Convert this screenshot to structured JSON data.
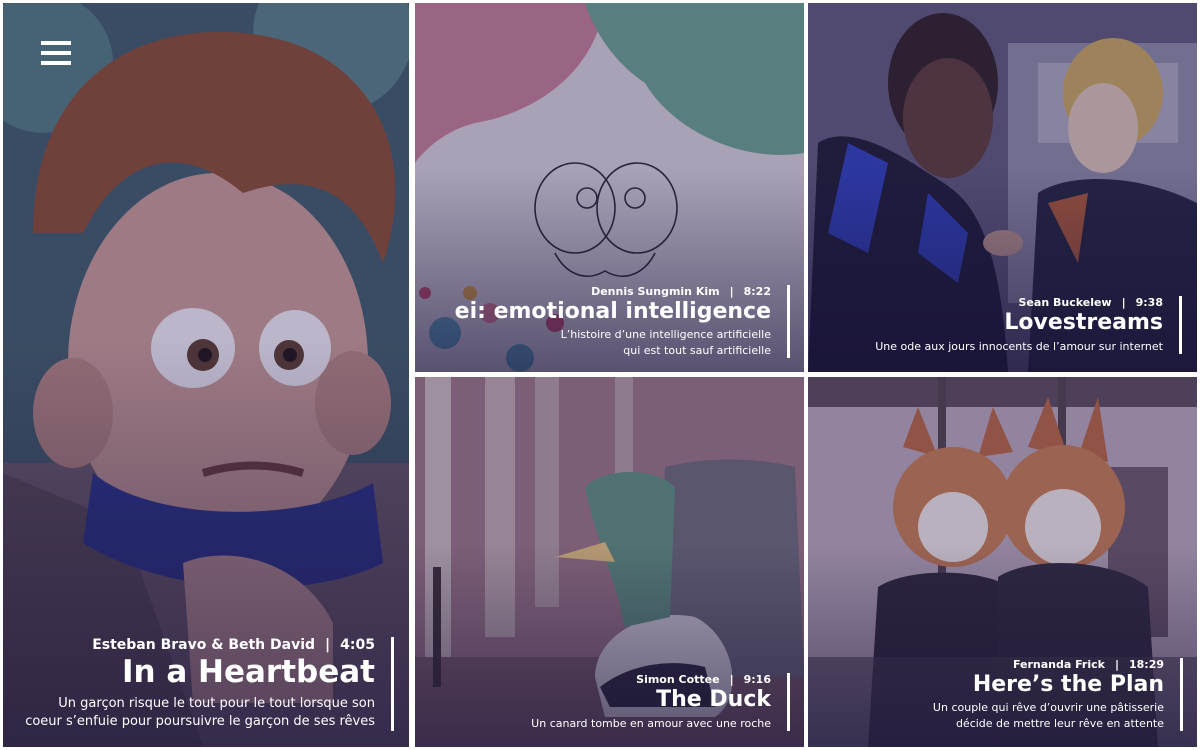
{
  "menu": {
    "icon": "hamburger-menu-icon"
  },
  "films": [
    {
      "id": "heartbeat",
      "director": "Esteban Bravo & Beth David",
      "duration": "4:05",
      "title": "In a Heartbeat",
      "description_lines": [
        "Un garçon risque le tout pour le tout lorsque son",
        "coeur s’enfuie pour poursuivre le garçon de ses rêves"
      ]
    },
    {
      "id": "ei",
      "director": "Dennis Sungmin Kim",
      "duration": "8:22",
      "title": "ei: emotional intelligence",
      "description_lines": [
        "L’histoire d’une intelligence artificielle",
        "qui est tout sauf artificielle"
      ]
    },
    {
      "id": "lovestreams",
      "director": "Sean Buckelew",
      "duration": "9:38",
      "title": "Lovestreams",
      "description_lines": [
        "Une ode aux jours innocents de l’amour sur internet"
      ]
    },
    {
      "id": "duck",
      "director": "Simon Cottee",
      "duration": "9:16",
      "title": "The Duck",
      "description_lines": [
        "Un canard tombe en amour avec une roche"
      ]
    },
    {
      "id": "plan",
      "director": "Fernanda Frick",
      "duration": "18:29",
      "title": "Here’s the Plan",
      "description_lines": [
        "Un couple qui rêve d’ouvrir une pâtisserie",
        "décide de mettre leur rêve en attente"
      ]
    }
  ]
}
